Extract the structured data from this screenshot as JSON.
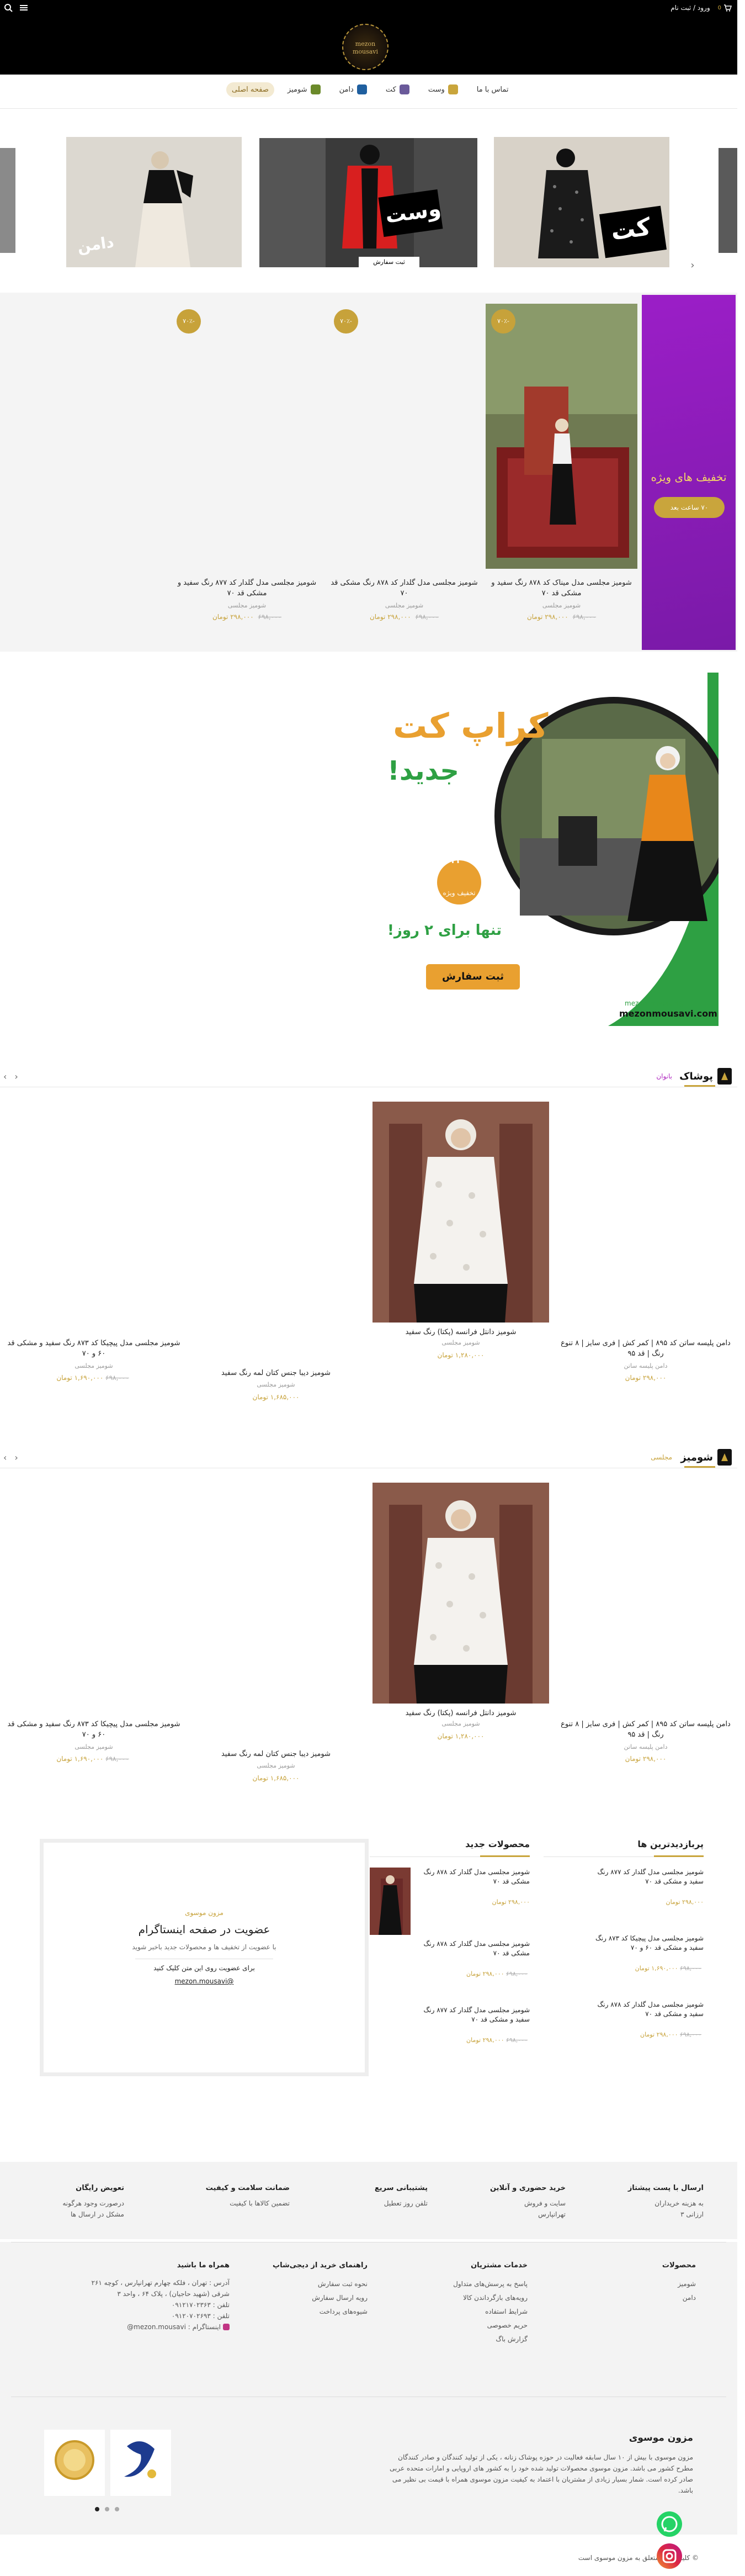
{
  "topbar": {
    "auth_label": "ورود / ثبت نام",
    "cart_count": "0",
    "search_icon": "search-icon",
    "cart_icon": "cart-icon"
  },
  "logo": {
    "text": "mezon mousavi"
  },
  "nav": {
    "items": [
      {
        "label": "صفحه اصلی",
        "icon": "home"
      },
      {
        "label": "شومیز",
        "icon": "shirt-icon"
      },
      {
        "label": "دامن",
        "icon": "skirt-icon"
      },
      {
        "label": "کت",
        "icon": "coat-icon"
      },
      {
        "label": "وست",
        "icon": "vest-icon"
      },
      {
        "label": "تماس با ما",
        "icon": ""
      }
    ]
  },
  "slider": {
    "labels": [
      "کت",
      "وست",
      "دامن"
    ],
    "cta": "ثبت سفارش"
  },
  "offers": {
    "banner_title": "تخفیف های ویژه",
    "banner_button": "۷۰ ساعت بعد",
    "badge": "-۷۰٪",
    "products": [
      {
        "name": "شومیز مجلسی مدل میناک کد ۸۷۸ رنگ سفید و مشکی قد ۷۰",
        "cat": "شومیز مجلسی",
        "old": "۶۹۸,۰۰۰",
        "price": "۲۹۸,۰۰۰ تومان"
      },
      {
        "name": "شومیز مجلسی مدل گلدار کد ۸۷۸ رنگ مشکی قد ۷۰",
        "cat": "شومیز مجلسی",
        "old": "۶۹۸,۰۰۰",
        "price": "۲۹۸,۰۰۰ تومان"
      },
      {
        "name": "شومیز مجلسی مدل گلدار کد ۸۷۷ رنگ سفید و مشکی قد ۷۰",
        "cat": "شومیز مجلسی",
        "old": "۶۹۸,۰۰۰",
        "price": "۲۹۸,۰۰۰ تومان"
      }
    ]
  },
  "promo": {
    "headline": "کراپ کت",
    "subline": "جدید!",
    "discount": "٪۲۰",
    "discount_label": "تخفیف ویژه",
    "duration": "تنها برای ۲ روز!",
    "cta": "ثبت سفارش",
    "instagram": "@mezon_mousavi",
    "website": "mezonmousavi.com"
  },
  "section_clothing": {
    "title": "پوشاک",
    "tab": "بانوان",
    "prev": "‹",
    "next": "›",
    "products": [
      {
        "name": "دامن پلیسه ساتن کد ۸۹۵ | کمر کش | فری سایز | ۸ تنوع رنگ | قد ۹۵",
        "cat": "دامن پلیسه ساتن",
        "old": "",
        "price": "۲۹۸,۰۰۰ تومان"
      },
      {
        "name": "شومیز دانتل فرانسه (پکتا) رنگ سفید",
        "cat": "شومیز مجلسی",
        "old": "",
        "price": "۱,۲۸۰,۰۰۰ تومان"
      },
      {
        "name": "شومیز دیبا جنس کتان لمه رنگ سفید",
        "cat": "شومیز مجلسی",
        "old": "",
        "price": "۱,۶۸۵,۰۰۰ تومان"
      },
      {
        "name": "شومیز مجلسی مدل پیچیکا کد ۸۷۳ رنگ سفید و مشکی قد ۶۰ و ۷۰",
        "cat": "شومیز مجلسی",
        "old": "۶۹۸,۰۰۰",
        "price": "۱,۶۹۰,۰۰۰ تومان"
      }
    ]
  },
  "section_shirts": {
    "title": "شومیز",
    "tab": "مجلسی",
    "prev": "‹",
    "next": "›",
    "products": [
      {
        "name": "دامن پلیسه ساتن کد ۸۹۵ | کمر کش | فری سایز | ۸ تنوع رنگ | قد ۹۵",
        "cat": "دامن پلیسه ساتن",
        "old": "",
        "price": "۲۹۸,۰۰۰ تومان"
      },
      {
        "name": "شومیز دانتل فرانسه (پکتا) رنگ سفید",
        "cat": "شومیز مجلسی",
        "old": "",
        "price": "۱,۲۸۰,۰۰۰ تومان"
      },
      {
        "name": "شومیز دیبا جنس کتان لمه رنگ سفید",
        "cat": "شومیز مجلسی",
        "old": "",
        "price": "۱,۶۸۵,۰۰۰ تومان"
      },
      {
        "name": "شومیز مجلسی مدل پیچیکا کد ۸۷۳ رنگ سفید و مشکی قد ۶۰ و ۷۰",
        "cat": "شومیز مجلسی",
        "old": "۶۹۸,۰۰۰",
        "price": "۱,۶۹۰,۰۰۰ تومان"
      }
    ]
  },
  "bestsellers": {
    "title": "پربازدیدترین ها",
    "items": [
      {
        "name": "شومیز مجلسی مدل گلدار کد ۸۷۷ رنگ سفید و مشکی قد ۷۰",
        "old": "",
        "price": "۲۹۸,۰۰۰ تومان"
      },
      {
        "name": "شومیز مجلسی مدل پیچیکا کد ۸۷۳ رنگ سفید و مشکی قد ۶۰ و ۷۰",
        "old": "۶۹۸,۰۰۰",
        "price": "۱,۶۹۰,۰۰۰ تومان"
      },
      {
        "name": "شومیز مجلسی مدل گلدار کد ۸۷۸ رنگ سفید و مشکی قد ۷۰",
        "old": "۶۹۸,۰۰۰",
        "price": "۲۹۸,۰۰۰ تومان"
      }
    ]
  },
  "newest": {
    "title": "محصولات جدید",
    "items": [
      {
        "name": "شومیز مجلسی مدل گلدار کد ۸۷۸ رنگ مشکی قد ۷۰",
        "old": "",
        "price": "۲۹۸,۰۰۰ تومان"
      },
      {
        "name": "شومیز مجلسی مدل گلدار کد ۸۷۸ رنگ مشکی قد ۷۰",
        "old": "۶۹۸,۰۰۰",
        "price": "۲۹۸,۰۰۰ تومان"
      },
      {
        "name": "شومیز مجلسی مدل گلدار کد ۸۷۷ رنگ سفید و مشکی قد ۷۰",
        "old": "۶۹۸,۰۰۰",
        "price": "۲۹۸,۰۰۰ تومان"
      }
    ]
  },
  "insta": {
    "subtitle": "مزون موسوی",
    "title": "عضویت در صفحه اینستاگرام",
    "desc": "با عضویت از تخفیف ها و محصولات جدید باخبر شوید",
    "cta": "برای عضویت روی این متن کلیک کنید",
    "handle": "@mezon.mousavi"
  },
  "features": [
    {
      "title": "ارسال با پست پیشتاز",
      "desc": "به هزینه خریداران\nارزانی ۳"
    },
    {
      "title": "خرید حضوری و آنلاین",
      "desc": "سایت و فروش\nتهرانپارس"
    },
    {
      "title": "پشتیبانی سریع",
      "desc": "تلفن روز تعطیل"
    },
    {
      "title": "ضمانت سلامت و کیفیت",
      "desc": "تضمین کالاها با کیفیت"
    },
    {
      "title": "تعویض رایگان",
      "desc": "درصورت وجود هرگونه\nمشکل در ارسال ها"
    }
  ],
  "footer": {
    "col_products": {
      "title": "محصولات",
      "links": [
        "شومیز",
        "دامن"
      ]
    },
    "col_services": {
      "title": "خدمات مشتریان",
      "links": [
        "پاسخ به پرسش‌های متداول",
        "رویه‌های بازگرداندن کالا",
        "شرایط استفاده",
        "حریم خصوصی",
        "گزارش باگ"
      ]
    },
    "col_guide": {
      "title": "راهنمای خرید از دیجی‌شاپ",
      "links": [
        "نحوه ثبت سفارش",
        "رویه ارسال سفارش",
        "شیوه‌های پرداخت"
      ]
    },
    "col_contact": {
      "title": "همراه ما باشید",
      "address": "آدرس : تهران ، فلکه چهارم تهرانپارس ، کوچه ۲۶۱ شرقی (شهید حاجیان) ، پلاک ۶۴ ، واحد ۳",
      "phone1": "تلفن : ۰۹۱۲۱۷۰۲۳۶۳",
      "phone2": "تلفن : ۰۹۱۲۰۷۰۲۶۹۳",
      "instagram": "اینستاگرام : mezon.mousavi@"
    }
  },
  "about": {
    "title": "مزون موسوی",
    "text": "مزون موسوی با بیش از ۱۰ سال سابقه فعالیت در حوزه پوشاک زنانه ، یکی از تولید کنندگان و صادر کنندگان مطرح کشور می باشد. مزون موسوی محصولات تولید شده خود را به کشور های اروپایی و امارات متحده عربی صادر کرده است. شمار بسیار زیادی از مشتریان با اعتماد به کیفیت مزون موسوی همراه با قیمت بی نظیر می باشد.",
    "badge1": "enamad",
    "badge2": "samandehi"
  },
  "bottom": {
    "copyright": "© کلیه حقوق متعلق به مزون موسوی است"
  },
  "colors": {
    "gold": "#c7a23a",
    "purple": "#8b1cbc",
    "black": "#000000",
    "whatsapp": "#25d366",
    "instagram": "#c13584"
  }
}
